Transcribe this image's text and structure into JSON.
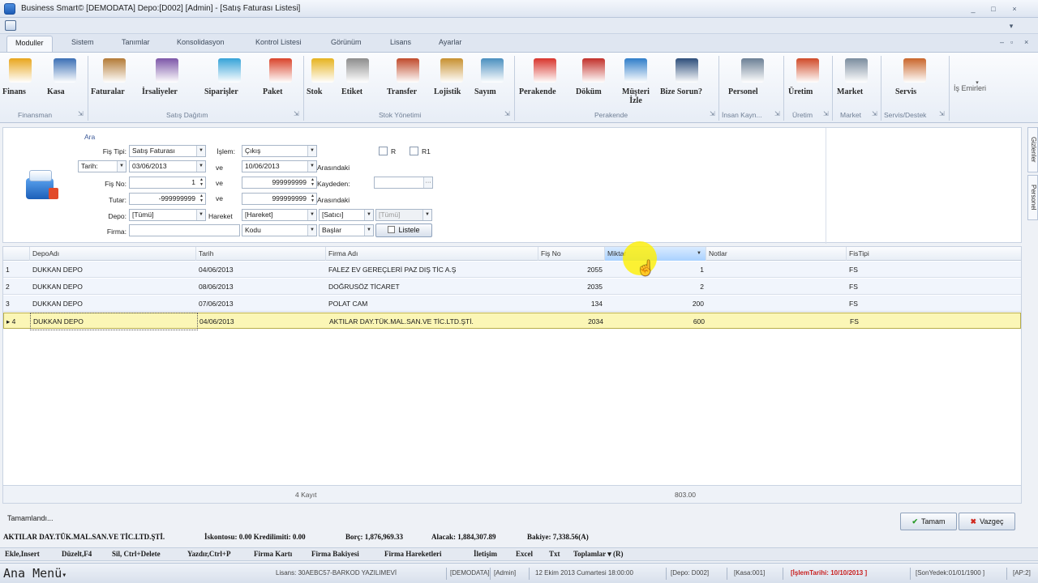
{
  "window": {
    "title": "Business Smart© [DEMODATA] Depo:[D002] [Admin] - [Satış Faturası Listesi]",
    "min": "_",
    "max": "□",
    "close": "×",
    "mdi_min": "–",
    "mdi_restore": "▫",
    "mdi_close": "×"
  },
  "tabs": [
    "Moduller",
    "Sistem",
    "Tanımlar",
    "Konsolidasyon",
    "Kontrol Listesi",
    "Görünüm",
    "Lisans",
    "Ayarlar"
  ],
  "ribbon": {
    "buttons": [
      "Finans",
      "Kasa",
      "Faturalar",
      "İrsaliyeler",
      "Siparişler",
      "Paket",
      "Stok",
      "Etiket",
      "Transfer",
      "Lojistik",
      "Sayım",
      "Perakende",
      "Döküm",
      "Müşteri İzle",
      "Bize Sorun?",
      "Personel",
      "Üretim",
      "Market",
      "Servis",
      "İş Emirleri"
    ],
    "groups": [
      "Finansman",
      "Satış Dağıtım",
      "Stok Yönetimi",
      "Perakende",
      "İnsan Kayn...",
      "Üretim",
      "Market",
      "Servis/Destek"
    ],
    "colors": [
      "#e8a61c",
      "#3b6fb5",
      "#b37a36",
      "#7c56a8",
      "#36a3d8",
      "#d9432a",
      "#e6b31f",
      "#8c8c8c",
      "#c04a2b",
      "#c7902f",
      "#4a8fbf",
      "#d8342c",
      "#c2302a",
      "#2f7dc9",
      "#2d4d7a",
      "#6b7f95",
      "#d04a28",
      "#7a8c9e",
      "#c9652a",
      "#8d9bb0"
    ]
  },
  "filter": {
    "section": "Ara",
    "fis_tipi_label": "Fiş Tipi:",
    "fis_tipi_value": "Satış Faturası",
    "islem_label": "İşlem:",
    "islem_value": "Çıkış",
    "chk1_label": "R",
    "chk2_label": "R1",
    "tarih_label": "Tarih:",
    "tarih_from": "03/06/2013",
    "ve": "ve",
    "tarih_to": "10/06/2013",
    "arasindaki": "Arasındaki",
    "fisno_label": "Fiş No:",
    "fisno_from": "1",
    "fisno_to": "999999999",
    "kaydeden_label": "Kaydeden:",
    "kaydeden_value": "",
    "ellipsis": "···",
    "tutar_label": "Tutar:",
    "tutar_from": "-999999999",
    "tutar_to": "999999999",
    "depo_label": "Depo:",
    "depo_value": "[Tümü]",
    "hareket_label": "Hareket",
    "hareket_value": "[Hareket]",
    "satici_value": "[Satıcı]",
    "tumu2_value": "[Tümü]",
    "firma_label": "Firma:",
    "firma_value": "",
    "kodu_value": "Kodu",
    "baslar_value": "Başlar",
    "listele_label": "Listele"
  },
  "grid": {
    "columns": [
      "DepoAdı",
      "Tarih",
      "Firma Adı",
      "Fiş No",
      "Miktar",
      "Notlar",
      "FisTipi"
    ],
    "rows": [
      {
        "n": "1",
        "depo": "DUKKAN DEPO",
        "tarih": "04/06/2013",
        "firma": "FALEZ EV GEREÇLERİ PAZ DIŞ TİC A.Ş",
        "fisno": "2055",
        "miktar": "1",
        "notlar": "",
        "fistipi": "FS"
      },
      {
        "n": "2",
        "depo": "DUKKAN DEPO",
        "tarih": "08/06/2013",
        "firma": "DOĞRUSÖZ TİCARET",
        "fisno": "2035",
        "miktar": "2",
        "notlar": "",
        "fistipi": "FS"
      },
      {
        "n": "3",
        "depo": "DUKKAN DEPO",
        "tarih": "07/06/2013",
        "firma": "POLAT CAM",
        "fisno": "134",
        "miktar": "200",
        "notlar": "",
        "fistipi": "FS"
      },
      {
        "n": "▸ 4",
        "depo": "DUKKAN DEPO",
        "tarih": "04/06/2013",
        "firma": "AKTILAR DAY.TÜK.MAL.SAN.VE TİC.LTD.ŞTİ.",
        "fisno": "2034",
        "miktar": "600",
        "notlar": "",
        "fistipi": "FS"
      }
    ],
    "footer_count": "4 Kayıt",
    "footer_sum": "803.00"
  },
  "status_text": "Tamamlandı...",
  "buttons": {
    "tamam": "Tamam",
    "vazgec": "Vazgeç"
  },
  "side_tabs": [
    "Gizlenler",
    "Personel"
  ],
  "info": {
    "firma": "AKTILAR DAY.TÜK.MAL.SAN.VE TİC.LTD.ŞTİ.",
    "iskonto": "İskontosu: 0.00 Kredilimiti: 0.00",
    "borc": "Borç: 1,876,969.33",
    "alacak": "Alacak: 1,884,307.89",
    "bakiye": "Bakiye: 7,338.56(A)"
  },
  "shortcuts": [
    "Ekle,Insert",
    "Düzelt,F4",
    "Sil, Ctrl+Delete",
    "Yazdır,Ctrl+P",
    "Firma Kartı",
    "Firma Bakiyesi",
    "Firma Hareketleri",
    "İletişim",
    "Excel",
    "Txt",
    "Toplamlar ▾ (R)"
  ],
  "statusbar": {
    "menu": "Ana Menü",
    "items": [
      "Lisans: 30AEBC57-BARKOD YAZILIMEVİ",
      "[DEMODATA]",
      "[Admin]",
      "12 Ekim 2013 Cumartesi 18:00:00",
      "[Depo: D002]",
      "[Kasa:001]",
      "[İşlemTarihi: 10/10/2013 ]",
      "[SonYedek:01/01/1900 ]",
      "[AP:2]"
    ]
  }
}
